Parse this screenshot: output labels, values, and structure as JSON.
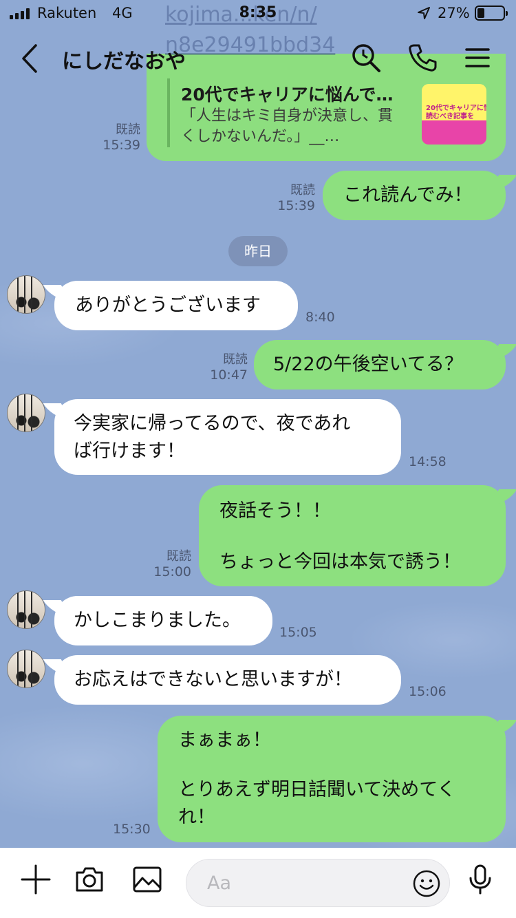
{
  "status_bar": {
    "carrier": "Rakuten",
    "network": "4G",
    "time": "8:35",
    "battery": "27%",
    "battery_level": 0.27
  },
  "header": {
    "title": "にしだなおや",
    "faded_url_line1": "kojima...ken/n/",
    "faded_url_line2": "n8e29491bbd34",
    "icons": [
      "back-chevron-icon",
      "search-icon",
      "phone-icon",
      "menu-icon"
    ]
  },
  "link_card": {
    "title": "20代でキャリアに悩んで…",
    "description": "「人生はキミ自身が決意し、貫くしかないんだ。」__…",
    "thumb_text": "20代でキャリアに悩 絶対読むべき記事を",
    "read": "既読",
    "time": "15:39"
  },
  "date_divider": "昨日",
  "messages": [
    {
      "side": "mine",
      "text": "これ読んでみ！",
      "read": "既読",
      "time": "15:39"
    },
    {
      "side": "theirs",
      "text": "ありがとうございます",
      "time": "8:40"
    },
    {
      "side": "mine",
      "text": "5/22の午後空いてる？",
      "read": "既読",
      "time": "10:47"
    },
    {
      "side": "theirs",
      "line1": "今実家に帰ってるので、夜であれ",
      "line2": "ば行けます！",
      "time": "14:58"
    },
    {
      "side": "mine",
      "line1": "夜話そう！！",
      "line2": "ちょっと今回は本気で誘う！",
      "read": "既読",
      "time": "15:00"
    },
    {
      "side": "theirs",
      "text": "かしこまりました。",
      "time": "15:05"
    },
    {
      "side": "theirs",
      "text": "お応えはできないと思いますが！",
      "time": "15:06"
    },
    {
      "side": "mine",
      "line1": "まぁまぁ！",
      "line2": "とりあえず明日話聞いて決めてく",
      "line3": "れ！",
      "time": "15:30"
    }
  ],
  "input_bar": {
    "placeholder": "Aa",
    "icons": [
      "plus-icon",
      "camera-icon",
      "image-icon",
      "emoji-icon",
      "microphone-icon"
    ]
  },
  "colors": {
    "background": "#8fa9d3",
    "my_bubble": "#8de07f",
    "their_bubble": "#ffffff"
  }
}
